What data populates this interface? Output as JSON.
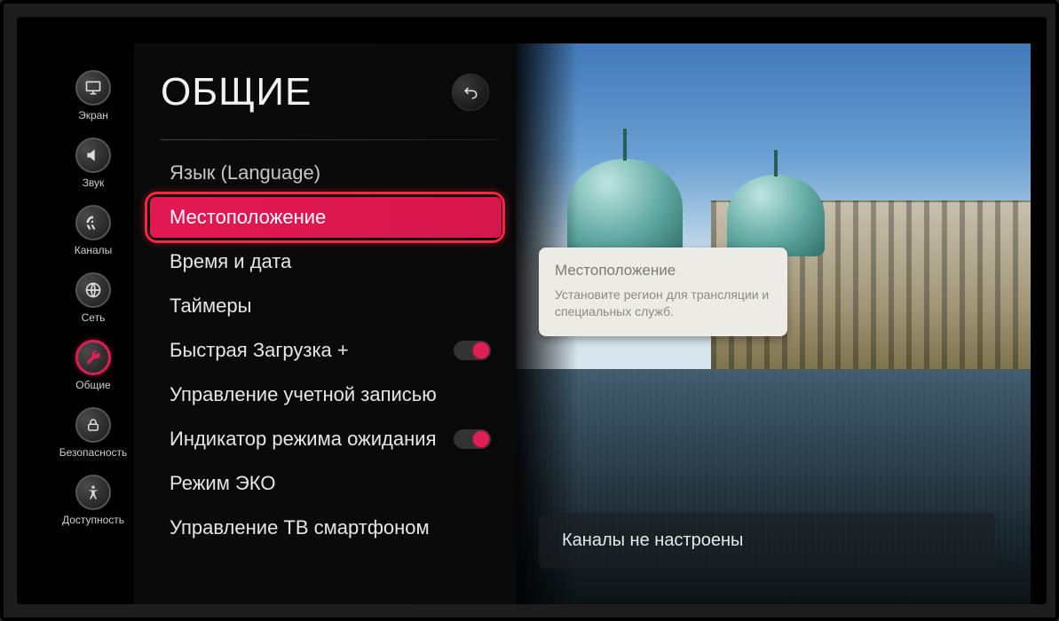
{
  "sidebar": {
    "items": [
      {
        "id": "screen",
        "label": "Экран"
      },
      {
        "id": "sound",
        "label": "Звук"
      },
      {
        "id": "channels",
        "label": "Каналы"
      },
      {
        "id": "network",
        "label": "Сеть"
      },
      {
        "id": "general",
        "label": "Общие"
      },
      {
        "id": "security",
        "label": "Безопасность"
      },
      {
        "id": "accessibility",
        "label": "Доступность"
      }
    ],
    "active_id": "general"
  },
  "settings": {
    "title": "ОБЩИЕ",
    "items": [
      {
        "id": "language",
        "label": "Язык (Language)"
      },
      {
        "id": "location",
        "label": "Местоположение",
        "selected": true
      },
      {
        "id": "datetime",
        "label": "Время и дата"
      },
      {
        "id": "timers",
        "label": "Таймеры"
      },
      {
        "id": "quickstart",
        "label": "Быстрая Загрузка +",
        "toggle": true
      },
      {
        "id": "account",
        "label": "Управление учетной записью"
      },
      {
        "id": "standby-led",
        "label": "Индикатор режима ожидания",
        "toggle": true
      },
      {
        "id": "eco",
        "label": "Режим ЭКО"
      },
      {
        "id": "tv-phone",
        "label": "Управление ТВ смартфоном"
      }
    ]
  },
  "tooltip": {
    "title": "Местоположение",
    "body": "Установите регион для трансляции и специальных служб."
  },
  "banner": {
    "text": "Каналы не настроены"
  },
  "colors": {
    "accent": "#e01f57",
    "highlight_border": "#ff2440"
  }
}
